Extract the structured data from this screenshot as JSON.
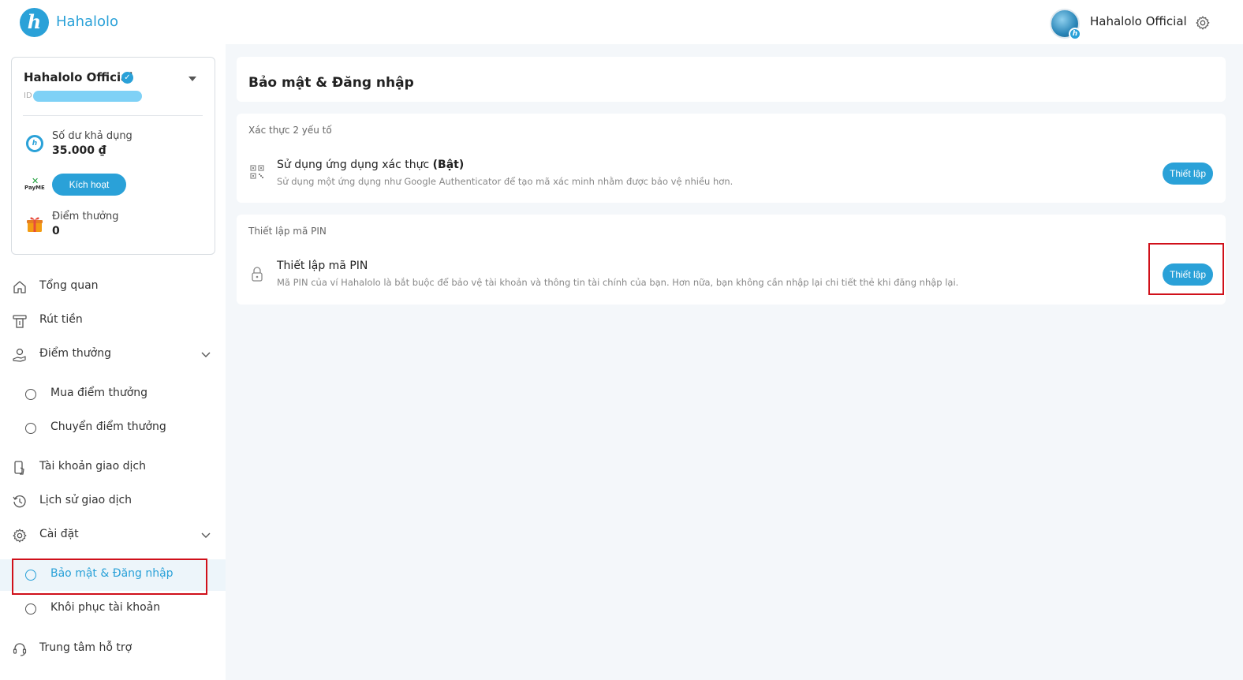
{
  "header": {
    "brand": "Hahalolo",
    "user_name": "Hahalolo Official"
  },
  "account": {
    "name": "Hahalolo Official",
    "id_label": "ID",
    "balance_label": "Số dư khả dụng",
    "balance_value": "35.000 ₫",
    "payme_text": "PayME",
    "activate_label": "Kích hoạt",
    "points_label": "Điểm thưởng",
    "points_value": "0"
  },
  "nav": {
    "overview": "Tổng quan",
    "withdraw": "Rút tiền",
    "rewards": "Điểm thưởng",
    "rewards_buy": "Mua điểm thưởng",
    "rewards_transfer": "Chuyển điểm thưởng",
    "trading_account": "Tài khoản giao dịch",
    "history": "Lịch sử giao dịch",
    "settings": "Cài đặt",
    "security_login": "Bảo mật & Đăng nhập",
    "account_recovery": "Khôi phục tài khoản",
    "support": "Trung tâm hỗ trợ"
  },
  "main": {
    "title": "Bảo mật & Đăng nhập",
    "two_factor": {
      "section": "Xác thực 2 yếu tố",
      "title": "Sử dụng ứng dụng xác thực",
      "status": "(Bật)",
      "desc": "Sử dụng một ứng dụng như Google Authenticator để tạo mã xác minh nhằm được bảo vệ nhiều hơn.",
      "button": "Thiết lập"
    },
    "pin": {
      "section": "Thiết lập mã PIN",
      "title": "Thiết lập mã PIN",
      "desc": "Mã PIN của ví Hahalolo là bắt buộc để bảo vệ tài khoản và thông tin tài chính của bạn. Hơn nữa, bạn không cần nhập lại chi tiết thẻ khi đăng nhập lại.",
      "button": "Thiết lập"
    }
  },
  "colors": {
    "accent": "#2aa1d8",
    "highlight": "#d0101a",
    "background": "#f4f7fa"
  }
}
